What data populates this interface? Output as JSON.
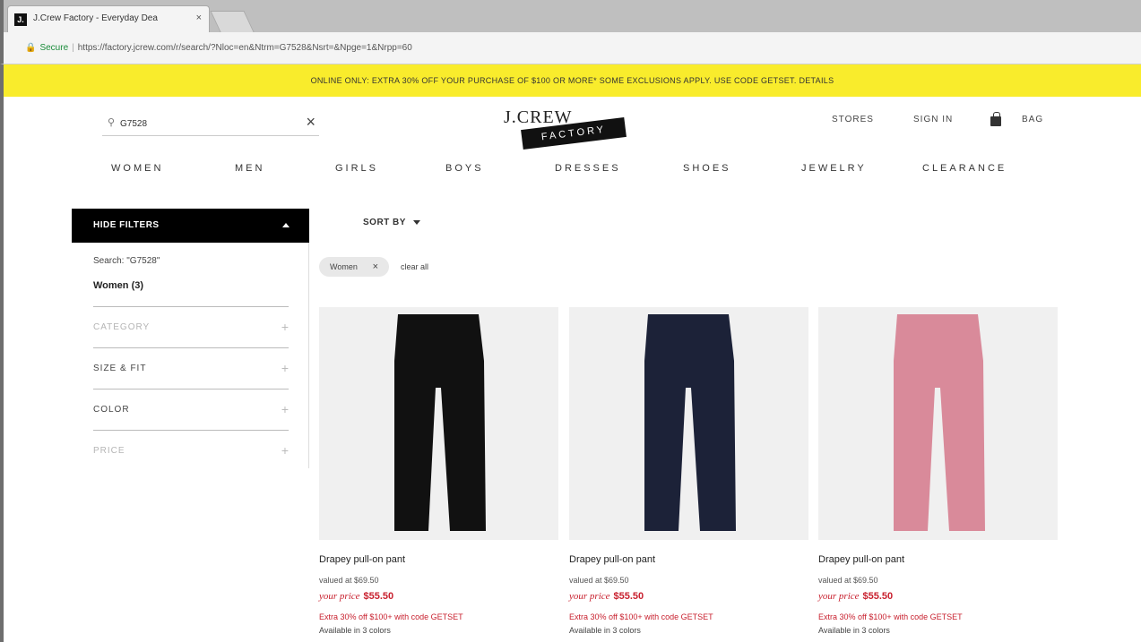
{
  "browser": {
    "tab_title": "J.Crew Factory - Everyday Dea",
    "tab_close": "×",
    "favicon_text": "J.",
    "secure_label": "Secure",
    "url": "https://factory.jcrew.com/r/search/?Nloc=en&Ntrm=G7528&Nsrt=&Npge=1&Nrpp=60"
  },
  "promo": {
    "text": "ONLINE ONLY: EXTRA 30% OFF YOUR PURCHASE OF $100 OR MORE* SOME EXCLUSIONS APPLY. USE CODE GETSET. DETAILS"
  },
  "header": {
    "search_value": "G7528",
    "clear_glyph": "×",
    "logo_top": "J.CREW",
    "logo_bottom": "FACTORY",
    "stores": "STORES",
    "sign_in": "SIGN IN",
    "bag": "BAG"
  },
  "nav": {
    "items": [
      "WOMEN",
      "MEN",
      "GIRLS",
      "BOYS",
      "DRESSES",
      "SHOES",
      "JEWELRY",
      "CLEARANCE"
    ]
  },
  "filters": {
    "toggle_label": "HIDE FILTERS",
    "search_term": "Search: \"G7528\"",
    "selected": "Women (3)",
    "groups": [
      {
        "label": "CATEGORY",
        "color": "#b5b5b5"
      },
      {
        "label": "SIZE & FIT",
        "color": "#444444"
      },
      {
        "label": "COLOR",
        "color": "#444444"
      },
      {
        "label": "PRICE",
        "color": "#b5b5b5"
      }
    ]
  },
  "results": {
    "sort_label": "SORT BY",
    "chip_label": "Women",
    "chip_remove": "×",
    "clear_all": "clear all"
  },
  "products": [
    {
      "name": "Drapey pull-on pant",
      "valued": "valued at $69.50",
      "price_label": "your price",
      "price": "$55.50",
      "promo": "Extra 30% off $100+ with code GETSET",
      "colors": "Available in 3 colors",
      "swatch": "#111111"
    },
    {
      "name": "Drapey pull-on pant",
      "valued": "valued at $69.50",
      "price_label": "your price",
      "price": "$55.50",
      "promo": "Extra 30% off $100+ with code GETSET",
      "colors": "Available in 3 colors",
      "swatch": "#1c2238"
    },
    {
      "name": "Drapey pull-on pant",
      "valued": "valued at $69.50",
      "price_label": "your price",
      "price": "$55.50",
      "promo": "Extra 30% off $100+ with code GETSET",
      "colors": "Available in 3 colors",
      "swatch": "#d98a9a"
    }
  ]
}
